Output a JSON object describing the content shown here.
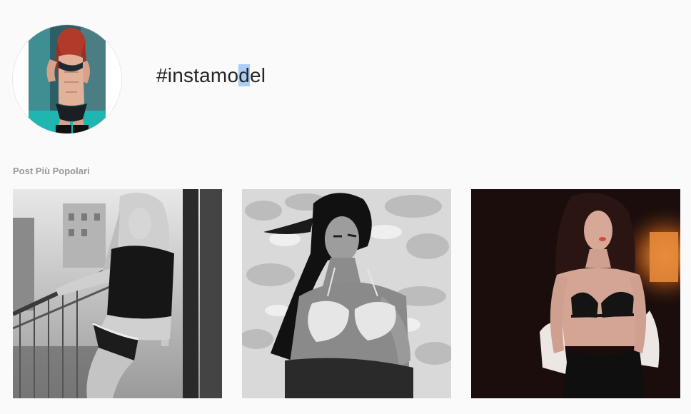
{
  "hashtag": {
    "prefix": "#instamo",
    "selected": "d",
    "suffix": "el"
  },
  "section": {
    "label": "Post Più Popolari"
  },
  "colors": {
    "background": "#fafafa",
    "title_text": "#262626",
    "section_label": "#999999",
    "selection_highlight": "#a9cdf7"
  }
}
